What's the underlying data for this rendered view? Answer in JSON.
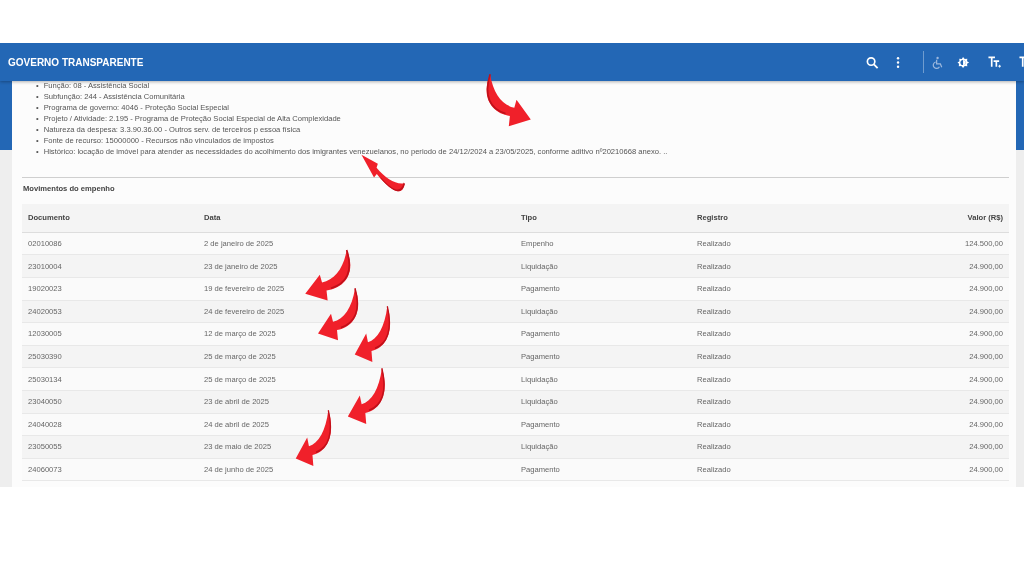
{
  "header": {
    "title": "GOVERNO TRANSPARENTE"
  },
  "details": [
    {
      "bullet": "•",
      "text": "Função: 08 - Assistência Social"
    },
    {
      "bullet": "•",
      "text": "Subfunção: 244 - Assistência Comunitária"
    },
    {
      "bullet": "•",
      "text": "Programa de governo: 4046 - Proteção Social Especial"
    },
    {
      "bullet": "•",
      "text": "Projeto / Atividade: 2.195 - Programa de Proteção Social Especial de Alta Complexidade"
    },
    {
      "bullet": "•",
      "text": "Natureza da despesa: 3.3.90.36.00 - Outros serv. de terceiros p essoa física"
    },
    {
      "bullet": "•",
      "text": "Fonte de recurso: 15000000 - Recursos não vinculados de impostos"
    },
    {
      "bullet": "•",
      "text": "Histórico: locação de imóvel para atender as necessidades do acolhimento dos imigrantes venezuelanos, no periodo de 24/12/2024 a 23/05/2025, conforme aditivo nº20210668 anexo. .."
    }
  ],
  "section_title": "Movimentos do empenho",
  "table": {
    "columns": [
      "Documento",
      "Data",
      "Tipo",
      "Registro",
      "Valor (R$)"
    ],
    "rows": [
      [
        "02010086",
        "2 de janeiro de 2025",
        "Empenho",
        "Realizado",
        "124.500,00"
      ],
      [
        "23010004",
        "23 de janeiro de 2025",
        "Liquidação",
        "Realizado",
        "24.900,00"
      ],
      [
        "19020023",
        "19 de fevereiro de 2025",
        "Pagamento",
        "Realizado",
        "24.900,00"
      ],
      [
        "24020053",
        "24 de fevereiro de 2025",
        "Liquidação",
        "Realizado",
        "24.900,00"
      ],
      [
        "12030005",
        "12 de março de 2025",
        "Pagamento",
        "Realizado",
        "24.900,00"
      ],
      [
        "25030390",
        "25 de março de 2025",
        "Pagamento",
        "Realizado",
        "24.900,00"
      ],
      [
        "25030134",
        "25 de março de 2025",
        "Liquidação",
        "Realizado",
        "24.900,00"
      ],
      [
        "23040050",
        "23 de abril de 2025",
        "Liquidação",
        "Realizado",
        "24.900,00"
      ],
      [
        "24040028",
        "24 de abril de 2025",
        "Pagamento",
        "Realizado",
        "24.900,00"
      ],
      [
        "23050055",
        "23 de maio de 2025",
        "Liquidação",
        "Realizado",
        "24.900,00"
      ],
      [
        "24060073",
        "24 de junho de 2025",
        "Pagamento",
        "Realizado",
        "24.900,00"
      ]
    ]
  }
}
